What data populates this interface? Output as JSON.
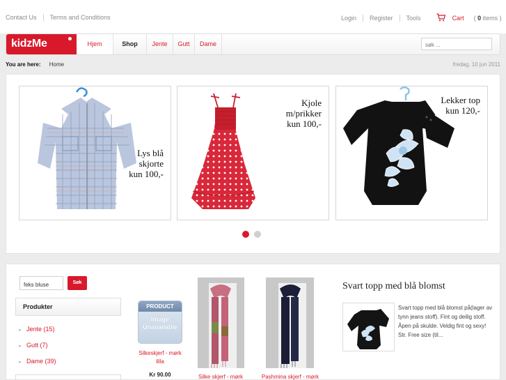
{
  "topbar": {
    "links_left": [
      "Contact Us",
      "Terms and Conditions"
    ],
    "links_right": [
      "Login",
      "Register",
      "Tools"
    ],
    "cart_label": "Cart",
    "cart_count_prefix": "( ",
    "cart_count": "0",
    "cart_count_suffix": " items )"
  },
  "nav": {
    "logo": "kidzMe",
    "items": [
      "Hjem",
      "Shop",
      "Jente",
      "Gutt",
      "Dame"
    ],
    "search_placeholder": "søk ..."
  },
  "breadcrumb": {
    "label": "You are here:",
    "current": "Home"
  },
  "date": "fredag, 10 jun 2011",
  "slider": {
    "slides": [
      {
        "lines": [
          "Lys blå",
          "skjorte",
          "kun 100,-"
        ]
      },
      {
        "lines": [
          "Kjole",
          "m/prikker",
          "kun 100,-"
        ]
      },
      {
        "lines": [
          "Lekker top",
          "kun 120,-"
        ]
      }
    ]
  },
  "sidebar": {
    "search_value": "feks bluse",
    "search_button": "Søk",
    "category_title": "Produkter",
    "categories": [
      "Jente (15)",
      "Gutt (7)",
      "Dame (39)"
    ]
  },
  "products": [
    {
      "name_lines": [
        "Silkeskjerf - mørk",
        "lilla"
      ],
      "price": "Kr 90.00",
      "image_band": "PRODUCT",
      "image_text_lines": [
        "Image",
        "Unavailable"
      ]
    },
    {
      "name_lines": [
        "Silke skjerf - mørk"
      ]
    },
    {
      "name_lines": [
        "Pashmina skjerf - mørk"
      ]
    }
  ],
  "featured": {
    "title": "Svart topp med blå blomst",
    "description": "Svart topp med blå blomst på(lager av tynn jeans stoff). Fint og deilig stoff. Åpen på skulde. Veldig fint og sexy! Str. Free size (til..."
  },
  "colors": {
    "accent": "#d8192b",
    "background": "#ececec"
  }
}
